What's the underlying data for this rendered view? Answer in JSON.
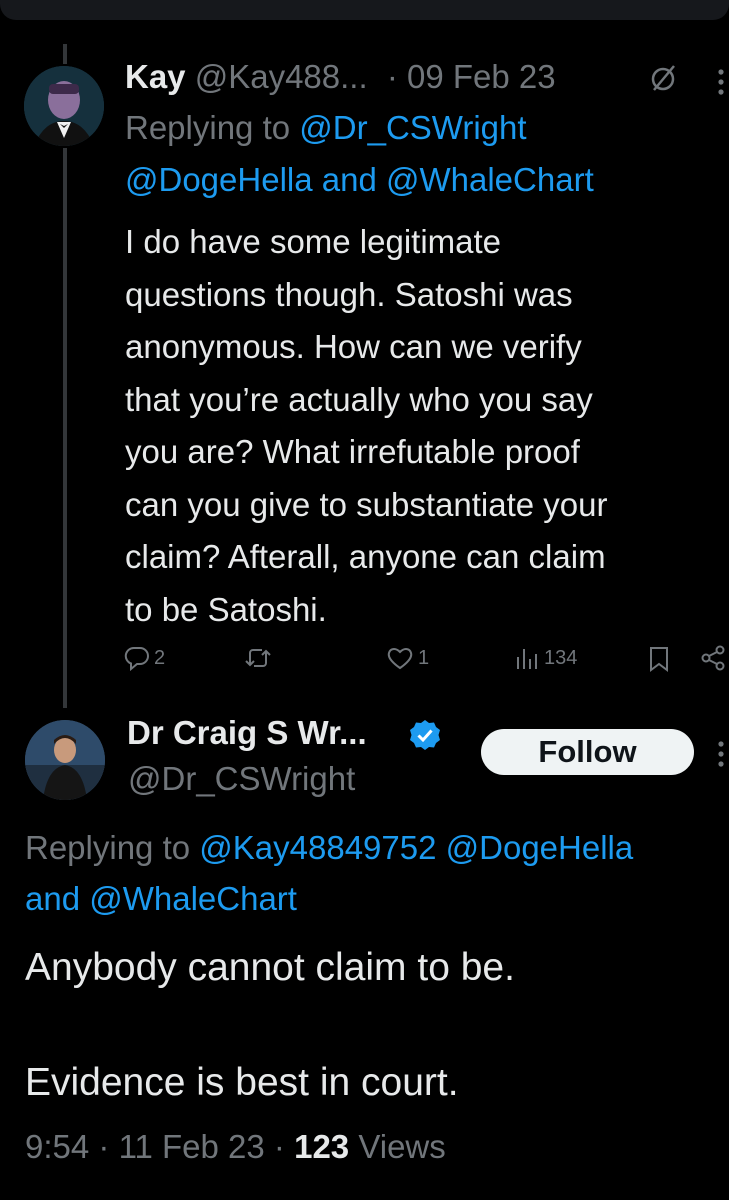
{
  "reply": {
    "author_name": "Kay",
    "author_handle": "@Kay488...",
    "separator": "·",
    "date": "09 Feb 23",
    "replying_to_label": "Replying to",
    "replying_to_user1": "@Dr_CSWright",
    "replying_to_user2": "@DogeHella",
    "replying_to_and": "and",
    "replying_to_user3": "@WhaleChart",
    "lines": [
      "I do have some legitimate",
      "questions though. Satoshi was",
      "anonymous. How can we verify",
      "that you’re actually who you say",
      "you are? What irrefutable proof",
      "can you give to substantiate your",
      "claim? Afterall, anyone can claim",
      "to be Satoshi."
    ],
    "reply_count": "2",
    "like_count": "1",
    "view_count": "134"
  },
  "main": {
    "author_name": "Dr Craig S Wr...",
    "author_handle": "@Dr_CSWright",
    "follow_label": "Follow",
    "replying_to_label": "Replying to",
    "replying_to_user1": "@Kay48849752",
    "replying_to_user2": "@DogeHella",
    "replying_to_and": "and",
    "replying_to_user3": "@WhaleChart",
    "text_line1": "Anybody cannot claim to be.",
    "text_line2": "Evidence is best in court.",
    "time": "9:54",
    "date": "11 Feb 23",
    "views_count": "123",
    "views_label": "Views",
    "separator": "·"
  },
  "colors": {
    "background": "#000000",
    "text": "#e7e9ea",
    "muted": "#71767b",
    "link": "#1d9bf0",
    "verified": "#1d9bf0"
  },
  "icons": [
    "reply-icon",
    "retweet-icon",
    "like-icon",
    "views-icon",
    "bookmark-icon",
    "share-icon",
    "edited-icon",
    "more-icon",
    "verified-badge-icon"
  ]
}
